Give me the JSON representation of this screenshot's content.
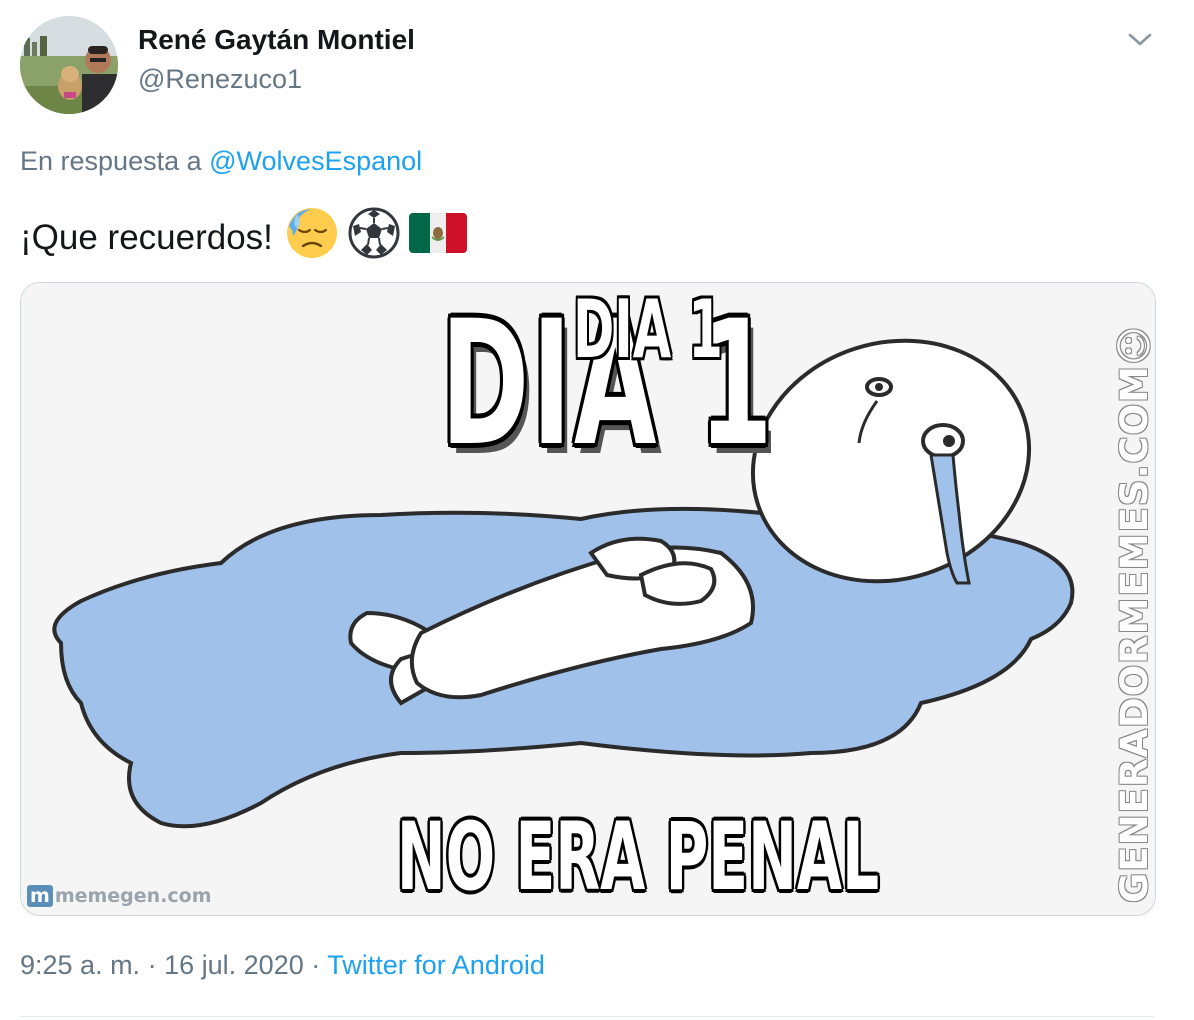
{
  "author": {
    "display_name": "René Gaytán Montiel",
    "handle": "@Renezuco1",
    "avatar_icon": "profile-photo"
  },
  "menu_icon": "chevron-down-icon",
  "reply": {
    "prefix": "En respuesta a",
    "mention": "@WolvesEspanol"
  },
  "tweet": {
    "text": "¡Que recuerdos!",
    "emojis": [
      "downcast-face-with-sweat-icon",
      "soccer-ball-icon",
      "mexico-flag-icon"
    ]
  },
  "media": {
    "title_big": "DIA 1",
    "title_small": "DIA 1",
    "caption": "NO ERA PENAL",
    "watermark_left": "memegen.com",
    "watermark_left_badge": "m",
    "watermark_right": "GENERADORMEMES.COM☺"
  },
  "footer": {
    "time": "9:25 a. m.",
    "date": "16 jul. 2020",
    "sep": "·",
    "source": "Twitter for Android"
  },
  "colors": {
    "link": "#1da1f2",
    "secondary": "#657786",
    "primary": "#14171a",
    "puddle": "#9fc1ea"
  }
}
